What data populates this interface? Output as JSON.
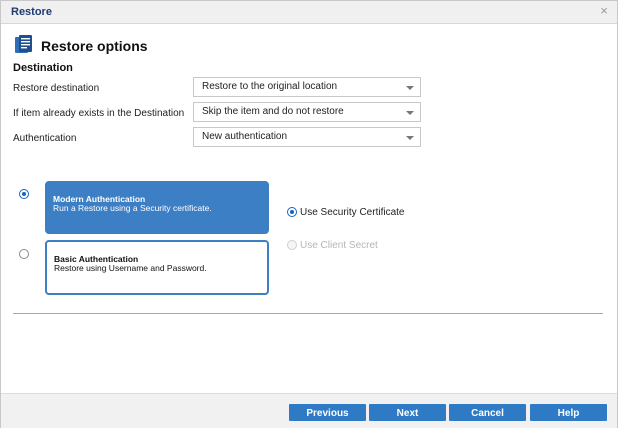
{
  "window": {
    "title": "Restore",
    "close_symbol": "×"
  },
  "header": {
    "title": "Restore options",
    "icon": "document-stack-icon"
  },
  "destination": {
    "section_title": "Destination",
    "rows": [
      {
        "label": "Restore destination",
        "value": "Restore to the original location"
      },
      {
        "label": "If item already exists in the Destination",
        "value": "Skip the item and do not restore"
      },
      {
        "label": "Authentication",
        "value": "New authentication"
      }
    ]
  },
  "auth_options": [
    {
      "title": "Modern Authentication",
      "description": "Run a Restore using a Security certificate.",
      "selected": true
    },
    {
      "title": "Basic Authentication",
      "description": "Restore using Username and Password.",
      "selected": false
    }
  ],
  "credential_options": [
    {
      "label": "Use Security Certificate",
      "selected": true,
      "enabled": true
    },
    {
      "label": "Use Client Secret",
      "selected": false,
      "enabled": false
    }
  ],
  "footer": {
    "buttons": [
      "Previous",
      "Next",
      "Cancel",
      "Help"
    ]
  },
  "colors": {
    "accent": "#2f7ac4",
    "card_selected": "#3d7fc5",
    "title_text": "#1f3a73"
  }
}
